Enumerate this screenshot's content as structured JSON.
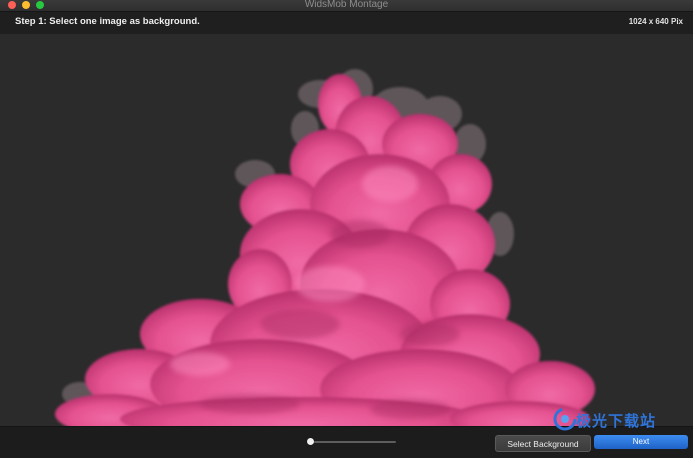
{
  "window": {
    "title": "WidsMob Montage"
  },
  "header": {
    "step": "Step 1: Select one image as background.",
    "size": "1024 x 640 Pix"
  },
  "footer": {
    "zoom_level": 0.03,
    "select_background_label": "Select Background",
    "next_label": "Next"
  },
  "watermark": {
    "text": "极光下载站"
  },
  "colors": {
    "smoke": "#e8508f",
    "canvas": "#2b2b2b",
    "accent": "#1f62c7"
  }
}
